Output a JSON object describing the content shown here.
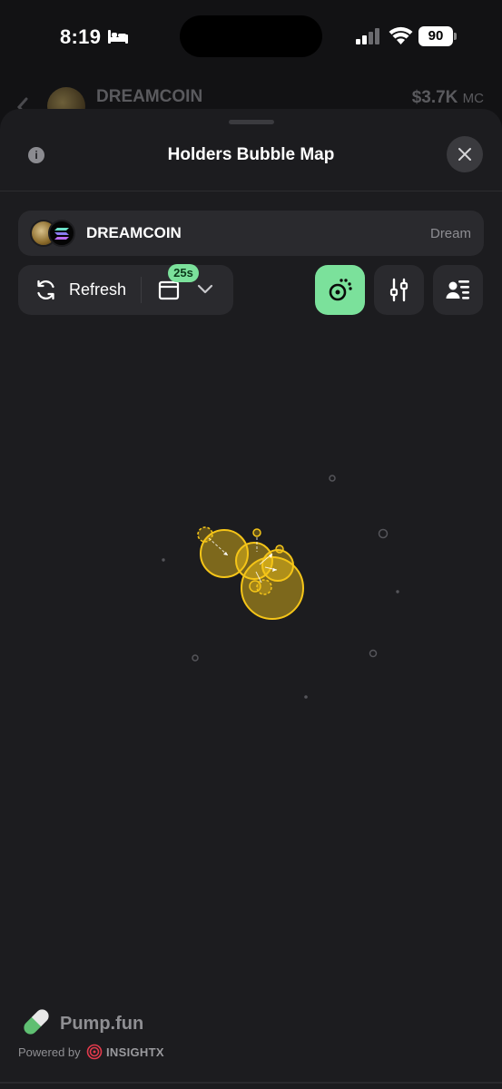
{
  "status_bar": {
    "time": "8:19",
    "battery": "90",
    "icons": [
      "bed-icon",
      "signal-icon",
      "wifi-icon",
      "battery-icon"
    ]
  },
  "background_page": {
    "back_icon": "chevron-left-icon",
    "token_name": "DREAMCOIN",
    "market_cap": "$3.7K",
    "market_cap_unit": "MC"
  },
  "sheet": {
    "title": "Holders Bubble Map",
    "info_icon": "i",
    "close_icon": "close-icon",
    "token": {
      "name": "DREAMCOIN",
      "symbol": "Dream",
      "chain_icon": "solana-icon"
    },
    "controls": {
      "refresh_label": "Refresh",
      "timer": "25s",
      "calendar_icon": "calendar-icon"
    },
    "tools": [
      "bubble-map-icon",
      "filter-sliders-icon",
      "holders-list-icon"
    ],
    "accent_color": "#7be19b"
  },
  "bubble_map": {
    "highlight_color": "#f5c518",
    "clusters": "yellow linked holders",
    "isolated_holders": 9
  },
  "footer": {
    "brand": "Pump.fun",
    "powered_by": "Powered by",
    "provider": "INSIGHTX"
  }
}
